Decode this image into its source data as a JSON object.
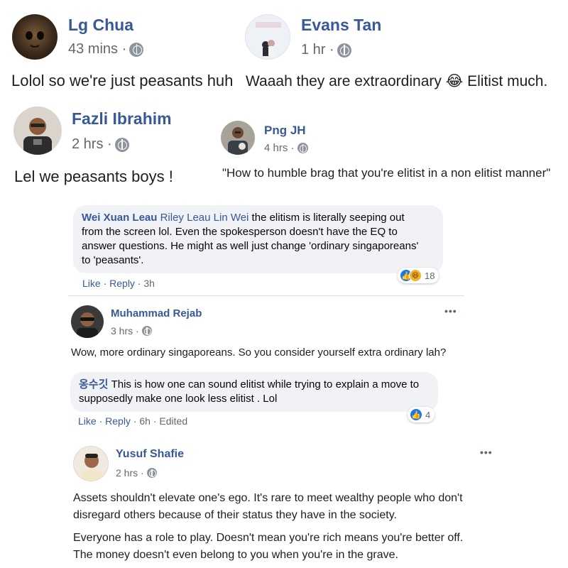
{
  "comments": [
    {
      "name": "Lg Chua",
      "time": "43 mins",
      "text": "Lolol so we're just peasants huh"
    },
    {
      "name": "Evans Tan",
      "time": "1 hr",
      "text": "Waaah they are extraordinary",
      "emoji": "😂",
      "text_after": "Elitist much."
    },
    {
      "name": "Fazli Ibrahim",
      "time": "2 hrs",
      "text": "Lel we peasants boys !"
    },
    {
      "name": "Png JH",
      "time": "4 hrs",
      "text": "\"How to humble brag that you're elitist in a non elitist manner\""
    }
  ],
  "reply1": {
    "author": "Wei Xuan Leau",
    "mention": "Riley Leau Lin Wei",
    "lines": [
      " the elitism is literally seeping out",
      "from the screen lol. Even the spokesperson doesn't have the EQ to",
      "answer questions. He might as well just change 'ordinary singaporeans'",
      "to 'peasants'."
    ],
    "like_label": "Like",
    "reply_label": "Reply",
    "time": "3h",
    "reaction_count": "18"
  },
  "comment5": {
    "name": "Muhammad Rejab",
    "time": "3 hrs",
    "text": "Wow, more ordinary singaporeans. So you consider yourself extra ordinary lah?",
    "menu": "•••"
  },
  "reply2": {
    "author": "옹수깃",
    "lines": [
      " This is how one can sound elitist while trying to explain a move to",
      "supposedly make one look less elitist . Lol"
    ],
    "like_label": "Like",
    "reply_label": "Reply",
    "time": "6h",
    "edited": "Edited",
    "reaction_count": "4"
  },
  "comment6": {
    "name": "Yusuf Shafie",
    "time": "2 hrs",
    "menu": "•••",
    "paragraphs": [
      [
        "Assets shouldn't elevate one's ego. It's rare to meet wealthy people who don't",
        "disregard others because of their status they have in the society."
      ],
      [
        "Everyone has a role to play. Doesn't mean you're rich means you're better off.",
        "The money doesn't even belong to you when you're in the grave."
      ]
    ]
  },
  "colors": {
    "link": "#385898",
    "meta": "#65676b",
    "bubble": "#f0f2f5",
    "like_blue": "#1877f2"
  }
}
